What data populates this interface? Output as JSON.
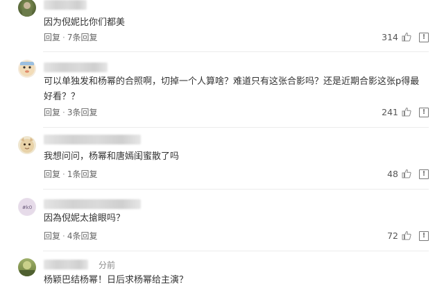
{
  "comments": [
    {
      "timestamp": "",
      "text": "因为倪妮比你们都美",
      "reply_label": "回复",
      "replies_label": "7条回复",
      "likes": "314"
    },
    {
      "timestamp": "",
      "text": "可以单独发和杨幂的合照啊，切掉一个人算啥？难道只有这张合影吗？还是近期合影这张p得最好看？？",
      "reply_label": "回复",
      "replies_label": "3条回复",
      "likes": "241"
    },
    {
      "timestamp": "",
      "text": "我想问问，杨幂和唐嫣闺蜜散了吗",
      "reply_label": "回复",
      "replies_label": "1条回复",
      "likes": "48"
    },
    {
      "timestamp": "",
      "text": "因為倪妮太搶眼吗？",
      "reply_label": "回复",
      "replies_label": "4条回复",
      "likes": "72"
    },
    {
      "timestamp": "分前",
      "text": "杨颖巴结杨幂！日后求杨幂给主演？",
      "reply_label": "",
      "replies_label": "",
      "likes": ""
    }
  ],
  "ui": {
    "separator": "·",
    "report_glyph": "!",
    "thumb_icon": "thumbs-up-icon",
    "report_icon": "report-icon",
    "accent_color": "#999999"
  }
}
